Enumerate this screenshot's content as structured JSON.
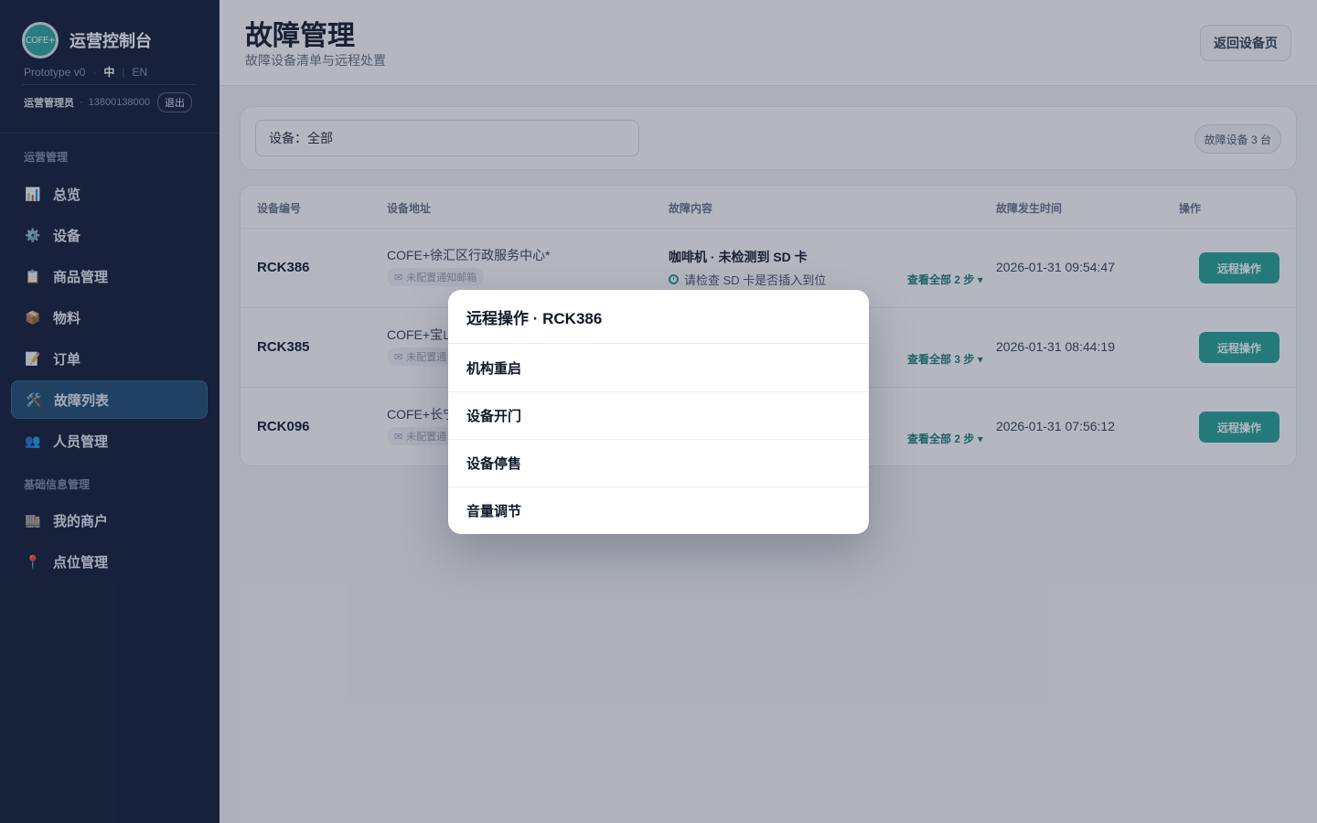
{
  "sidebar": {
    "logo_text": "COFE+",
    "title": "运营控制台",
    "version": "Prototype v0",
    "lang_active": "中",
    "lang_other": "EN",
    "user_role": "运营管理员",
    "user_phone": "13800138000",
    "logout_label": "退出",
    "section_ops": "运营管理",
    "section_base": "基础信息管理",
    "items": [
      {
        "label": "总览",
        "icon": "📊"
      },
      {
        "label": "设备",
        "icon": "⚙️"
      },
      {
        "label": "商品管理",
        "icon": "📋"
      },
      {
        "label": "物料",
        "icon": "📦"
      },
      {
        "label": "订单",
        "icon": "📝"
      },
      {
        "label": "故障列表",
        "icon": "🛠️"
      },
      {
        "label": "人员管理",
        "icon": "👥"
      },
      {
        "label": "我的商户",
        "icon": "🏬"
      },
      {
        "label": "点位管理",
        "icon": "📍"
      }
    ],
    "active_index": 5
  },
  "header": {
    "title": "故障管理",
    "subtitle": "故障设备清单与远程处置",
    "back_label": "返回设备页"
  },
  "filter": {
    "device_value": "设备：全部",
    "count_label": "故障设备 3 台"
  },
  "table": {
    "headers": [
      "设备编号",
      "设备地址",
      "故障内容",
      "故障发生时间",
      "操作"
    ],
    "rows": [
      {
        "code": "RCK386",
        "address": "COFE+徐汇区行政服务中心*",
        "mail_tag": "未配置通知邮箱",
        "fault": "咖啡机 · 未检测到 SD 卡",
        "hint": "请检查 SD 卡是否插入到位",
        "steps": "查看全部 2 步",
        "time": "2026-01-31 09:54:47",
        "action": "远程操作"
      },
      {
        "code": "RCK385",
        "address": "COFE+宝山",
        "mail_tag": "未配置通",
        "fault": "",
        "hint": "",
        "steps": "查看全部 3 步",
        "time": "2026-01-31 08:44:19",
        "action": "远程操作"
      },
      {
        "code": "RCK096",
        "address": "COFE+长宁",
        "mail_tag": "未配置通",
        "fault": "",
        "hint": "",
        "steps": "查看全部 2 步",
        "time": "2026-01-31 07:56:12",
        "action": "远程操作"
      }
    ]
  },
  "modal": {
    "title": "远程操作 · RCK386",
    "options": [
      "机构重启",
      "设备开门",
      "设备停售",
      "音量调节"
    ]
  },
  "colors": {
    "sidebar_bg": "#0f1a33",
    "accent": "#22a296",
    "active_nav": "#1c4a6e"
  }
}
